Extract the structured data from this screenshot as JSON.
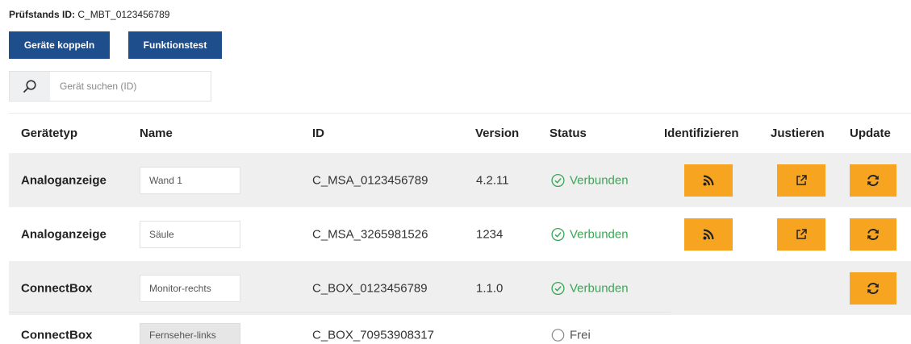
{
  "station": {
    "label": "Prüfstands ID:",
    "value": "C_MBT_0123456789"
  },
  "toolbar": {
    "pair_label": "Geräte koppeln",
    "test_label": "Funktionstest"
  },
  "search": {
    "placeholder": "Gerät suchen (ID)",
    "icon": "search-icon"
  },
  "table": {
    "headers": {
      "type": "Gerätetyp",
      "name": "Name",
      "id": "ID",
      "version": "Version",
      "status": "Status",
      "identify": "Identifizieren",
      "adjust": "Justieren",
      "update": "Update"
    },
    "rows": [
      {
        "type": "Analoganzeige",
        "name": "Wand 1",
        "id": "C_MSA_0123456789",
        "version": "4.2.11",
        "status": "Verbunden"
      },
      {
        "type": "Analoganzeige",
        "name": "Säule",
        "id": "C_MSA_3265981526",
        "version": "1234",
        "status": "Verbunden"
      },
      {
        "type": "ConnectBox",
        "name": "Monitor-rechts",
        "id": "C_BOX_0123456789",
        "version": "1.1.0",
        "status": "Verbunden"
      },
      {
        "type": "ConnectBox",
        "name": "Fernseher-links",
        "id": "C_BOX_70953908317",
        "version": "",
        "status": "Frei"
      }
    ]
  },
  "colors": {
    "primary": "#1f4e8c",
    "action": "#f7a520",
    "connected": "#3aa655",
    "row_alt": "#efefef"
  }
}
